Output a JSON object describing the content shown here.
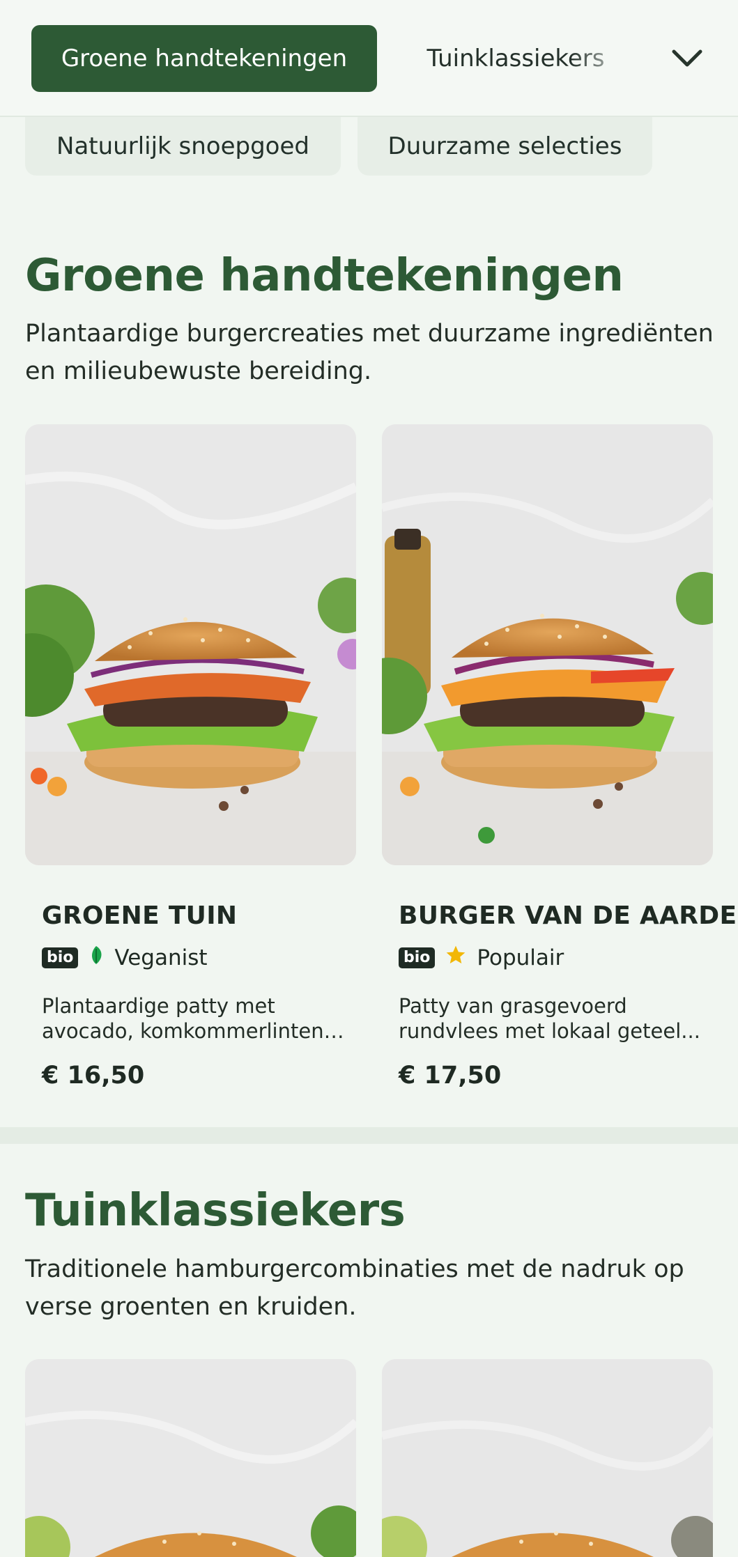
{
  "nav": {
    "active_chip": "Groene handtekeningen",
    "chip_2": "Tuinklassiekers",
    "row2_chip_1": "Natuurlijk snoepgoed",
    "row2_chip_2": "Duurzame selecties",
    "expand_icon": "chevron-down-icon"
  },
  "section_1": {
    "title": "Groene handtekeningen",
    "desc_line_1": "Plantaardige burgercreaties met duurzame ingrediënten",
    "desc_line_2": "en milieubewuste bereiding.",
    "cards": [
      {
        "name": "GROENE TUIN",
        "badge": "bio",
        "tag_icon": "leaf-icon",
        "tag": "Veganist",
        "desc_line_1": "Plantaardige patty met",
        "desc_line_2": "avocado, komkommerlinten,...",
        "price": "€ 16,50"
      },
      {
        "name": "BURGER VAN DE AARDE",
        "badge": "bio",
        "tag_icon": "star-icon",
        "tag": "Populair",
        "desc_line_1": "Patty van grasgevoerd",
        "desc_line_2": "rundvlees met lokaal geteel...",
        "price": "€ 17,50"
      }
    ]
  },
  "section_2": {
    "title": "Tuinklassiekers",
    "desc_line_1": "Traditionele hamburgercombinaties met de nadruk op",
    "desc_line_2": "verse groenten en kruiden."
  },
  "colors": {
    "brand_green": "#2d5a35",
    "page_bg": "#f1f6f1",
    "leaf_green": "#1aa34a",
    "star_yellow": "#f2b705"
  }
}
